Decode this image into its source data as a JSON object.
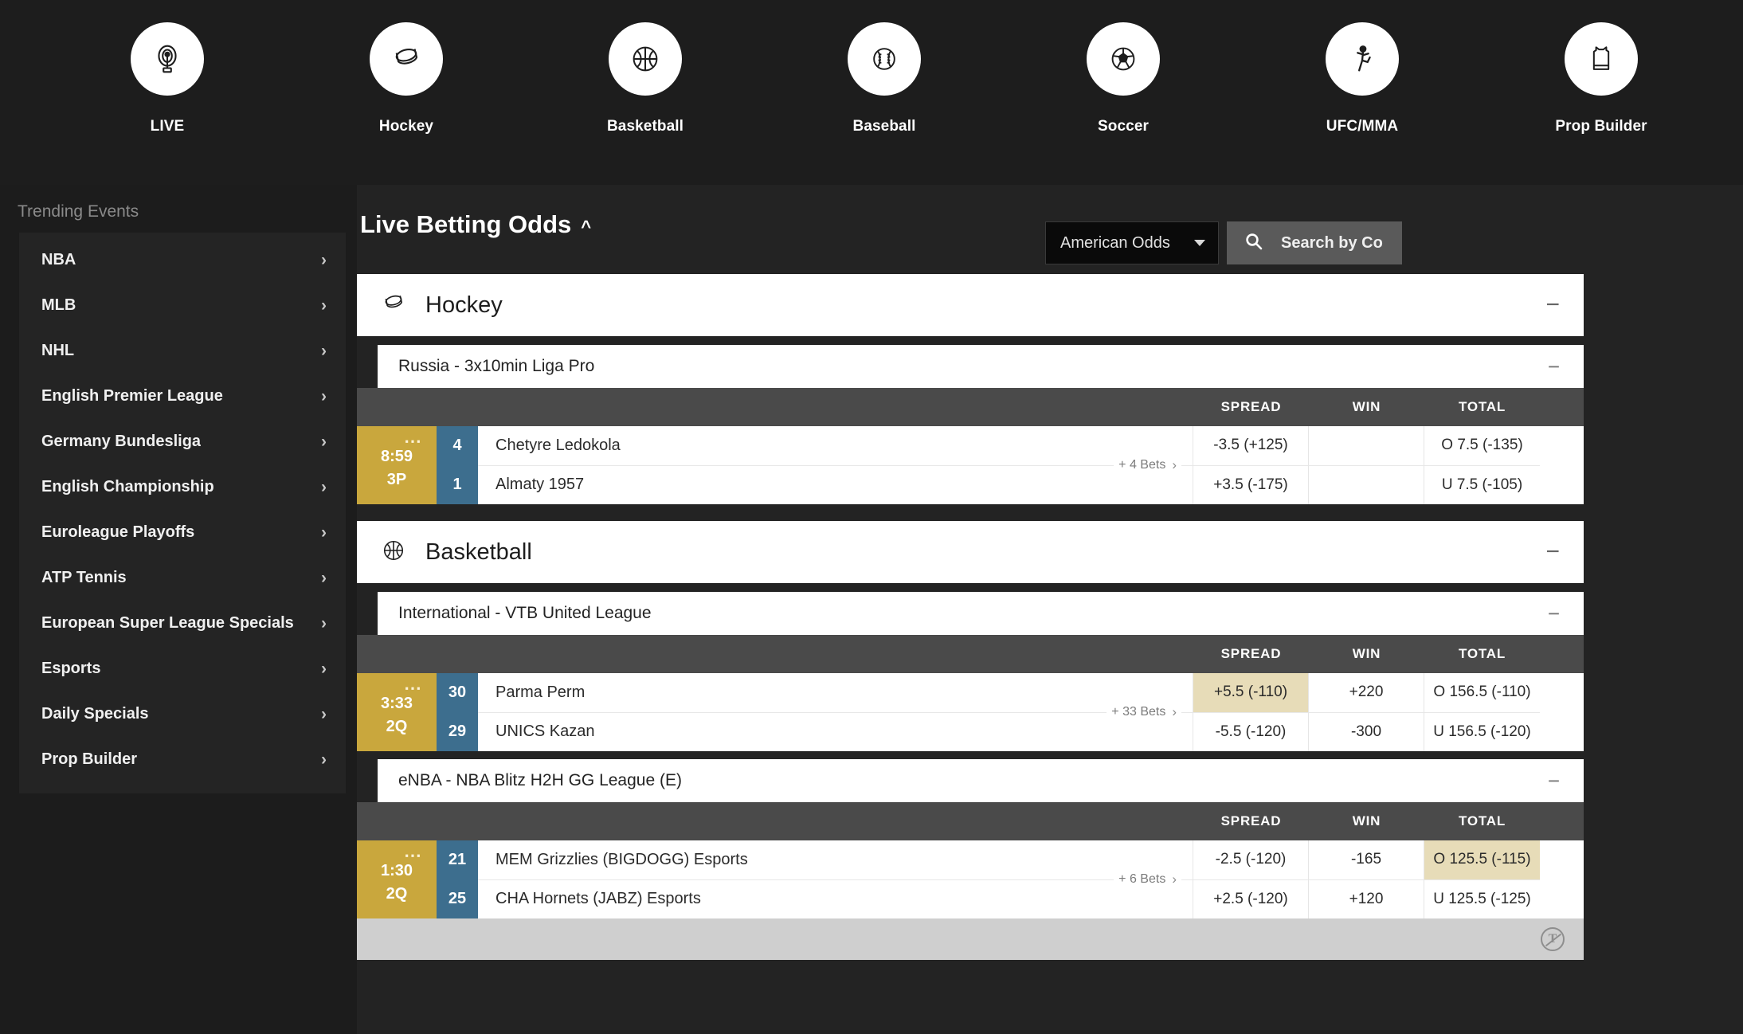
{
  "topnav": {
    "items": [
      {
        "label": "LIVE",
        "icon": "live-broadcast-icon"
      },
      {
        "label": "Hockey",
        "icon": "hockey-puck-icon"
      },
      {
        "label": "Basketball",
        "icon": "basketball-icon"
      },
      {
        "label": "Baseball",
        "icon": "baseball-icon"
      },
      {
        "label": "Soccer",
        "icon": "soccer-ball-icon"
      },
      {
        "label": "UFC/MMA",
        "icon": "martial-arts-icon"
      },
      {
        "label": "Prop Builder",
        "icon": "jersey-icon"
      }
    ]
  },
  "sidebar": {
    "heading": "Trending Events",
    "items": [
      {
        "label": "NBA"
      },
      {
        "label": "MLB"
      },
      {
        "label": "NHL"
      },
      {
        "label": "English Premier League"
      },
      {
        "label": "Germany Bundesliga"
      },
      {
        "label": "English Championship"
      },
      {
        "label": "Euroleague Playoffs"
      },
      {
        "label": "ATP Tennis"
      },
      {
        "label": "European Super League Specials"
      },
      {
        "label": "Esports"
      },
      {
        "label": "Daily Specials"
      },
      {
        "label": "Prop Builder"
      }
    ]
  },
  "header": {
    "title": "Live Betting Odds",
    "collapse_chevron": "^",
    "odds_format": "American Odds",
    "search_placeholder": "Search by Co"
  },
  "columns": {
    "spread": "SPREAD",
    "win": "WIN",
    "total": "TOTAL"
  },
  "collapse_symbol": "−",
  "sports": [
    {
      "name": "Hockey",
      "icon": "hockey-puck-icon",
      "leagues": [
        {
          "name": "Russia - 3x10min Liga Pro",
          "matches": [
            {
              "time": "8:59",
              "period": "3P",
              "bets_label": "+ 4 Bets",
              "away": {
                "score": "4",
                "team": "Chetyre Ledokola",
                "spread": "-3.5 (+125)",
                "win": "",
                "total": "O 7.5 (-135)",
                "highlight": ""
              },
              "home": {
                "score": "1",
                "team": "Almaty 1957",
                "spread": "+3.5 (-175)",
                "win": "",
                "total": "U 7.5 (-105)",
                "highlight": ""
              }
            }
          ]
        }
      ]
    },
    {
      "name": "Basketball",
      "icon": "basketball-icon",
      "leagues": [
        {
          "name": "International - VTB United League",
          "matches": [
            {
              "time": "3:33",
              "period": "2Q",
              "bets_label": "+ 33 Bets",
              "away": {
                "score": "30",
                "team": "Parma Perm",
                "spread": "+5.5 (-110)",
                "win": "+220",
                "total": "O 156.5 (-110)",
                "highlight": "spread"
              },
              "home": {
                "score": "29",
                "team": "UNICS Kazan",
                "spread": "-5.5 (-120)",
                "win": "-300",
                "total": "U 156.5 (-120)",
                "highlight": ""
              }
            }
          ]
        },
        {
          "name": "eNBA - NBA Blitz H2H GG League (E)",
          "matches": [
            {
              "time": "1:30",
              "period": "2Q",
              "bets_label": "+ 6 Bets",
              "away": {
                "score": "21",
                "team": "MEM Grizzlies (BIGDOGG) Esports",
                "spread": "-2.5 (-120)",
                "win": "-165",
                "total": "O 125.5 (-115)",
                "highlight": "total"
              },
              "home": {
                "score": "25",
                "team": "CHA Hornets (JABZ) Esports",
                "spread": "+2.5 (-120)",
                "win": "+120",
                "total": "U 125.5 (-125)",
                "highlight": ""
              }
            }
          ]
        }
      ]
    }
  ],
  "footer": {
    "badge_glyph": "T"
  },
  "colors": {
    "gold": "#c9a73d",
    "steel_blue": "#3d6e8e",
    "highlight": "#e7dcb8",
    "page_bg": "#1c1c1c",
    "card_bg": "#ffffff",
    "col_head_bg": "#4a4a4a"
  }
}
